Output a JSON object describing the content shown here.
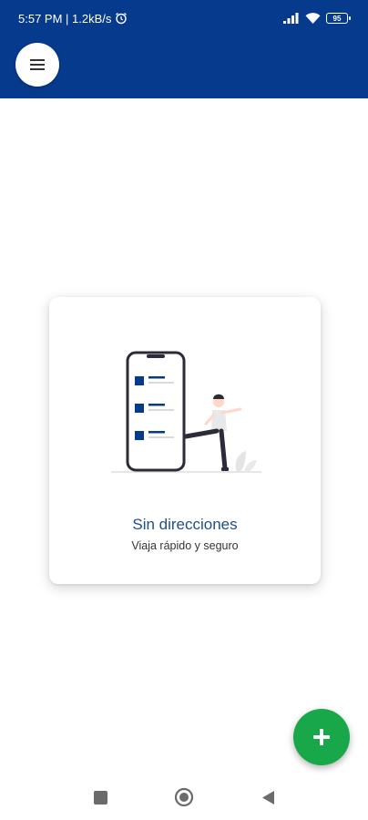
{
  "status_bar": {
    "time_speed": "5:57 PM | 1.2kB/s",
    "battery": "95",
    "icons": [
      "alarm-icon",
      "signal-icon",
      "wifi-icon",
      "battery-icon"
    ]
  },
  "app_bar": {
    "menu_icon": "hamburger-menu-icon",
    "background_color": "#063a8c"
  },
  "empty_state": {
    "title": "Sin direcciones",
    "subtitle": "Viaja rápido y seguro",
    "illustration": "person-kicking-phone-list"
  },
  "fab": {
    "icon": "plus-icon",
    "color": "#18a84a"
  },
  "nav": {
    "icons": [
      "recent-apps-icon",
      "home-icon",
      "back-icon"
    ]
  }
}
